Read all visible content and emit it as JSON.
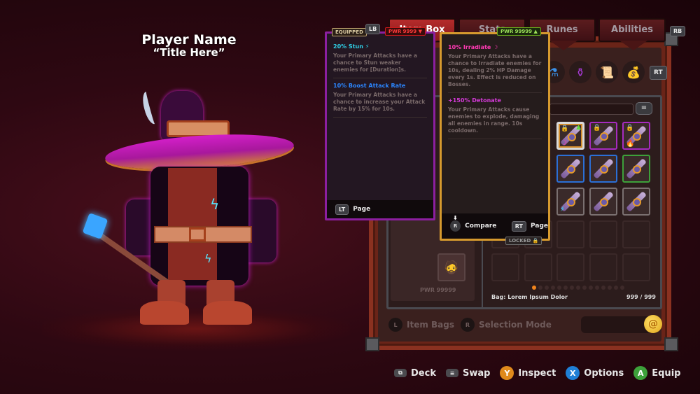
{
  "player": {
    "name": "Player Name",
    "title": "“Title Here”"
  },
  "tabs": [
    {
      "label": "Item Box",
      "active": true
    },
    {
      "label": "Stats",
      "active": false
    },
    {
      "label": "Runes",
      "active": false
    },
    {
      "label": "Abilities",
      "active": false
    }
  ],
  "shoulder_hints": {
    "left": "LB",
    "right": "RB",
    "rt": "RT"
  },
  "bag_tabs": [
    {
      "icon": "potion-bag-blue-icon",
      "glyph": "⚗"
    },
    {
      "icon": "potion-bag-purple-icon",
      "glyph": "⚱"
    },
    {
      "icon": "scroll-icon",
      "glyph": "📜"
    },
    {
      "icon": "coin-sack-icon",
      "glyph": "💰"
    }
  ],
  "equipped_tooltip": {
    "tag": "EQUIPPED",
    "power": "PWR 9999",
    "power_trend": "down",
    "power_color": "#ff3a3a",
    "effects": [
      {
        "title": "20% Stun ⚡",
        "color": "#2fd0e6",
        "desc": "Your Primary Attacks have a chance to Stun weaker enemies for [Duration]s."
      },
      {
        "title": "10% Boost Attack Rate",
        "color": "#2b86ff",
        "desc": "Your Primary Attacks have a chance to increase your Attack Rate by 15% for 10s."
      }
    ],
    "footer": {
      "button": "LT",
      "label": "Page"
    }
  },
  "compare_tooltip": {
    "power": "PWR 99999",
    "power_trend": "up",
    "power_color": "#9de35a",
    "effects": [
      {
        "title": "10% Irradiate ☽",
        "color": "#ff3ab4",
        "desc": "Your Primary Attacks have a chance to Irradiate enemies for 10s, dealing 2% HP Damage every 1s. Effect is reduced on Bosses."
      },
      {
        "title": "+150% Detonate",
        "color": "#d43ad8",
        "desc": "Your Primary Attacks cause enemies to explode, damaging all enemies in range. 10s cooldown."
      }
    ],
    "footer": {
      "compare_button": "R",
      "compare_label": "Compare",
      "page_button": "RT",
      "page_label": "Page"
    },
    "locked_tag": "LOCKED"
  },
  "inventory": {
    "items": [
      {
        "rarity_color": "#d18a2a",
        "locked": true,
        "selected": true,
        "upgrade": true,
        "badge": "☽",
        "badge_color": "#ff3ab4"
      },
      {
        "rarity_color": "#a62bc0",
        "locked": true,
        "selected": false,
        "upgrade": false,
        "badge": "",
        "badge_color": ""
      },
      {
        "rarity_color": "#a62bc0",
        "locked": true,
        "selected": false,
        "upgrade": false,
        "badge": "🔥",
        "badge_color": "#ff6a1a"
      },
      {
        "rarity_color": "#2b6fd6",
        "locked": false,
        "selected": false,
        "upgrade": false,
        "badge": "",
        "badge_color": ""
      },
      {
        "rarity_color": "#2b6fd6",
        "locked": false,
        "selected": false,
        "upgrade": false,
        "badge": "",
        "badge_color": ""
      },
      {
        "rarity_color": "#3da13a",
        "locked": false,
        "selected": false,
        "upgrade": false,
        "badge": "",
        "badge_color": ""
      },
      {
        "rarity_color": "#7a7070",
        "locked": false,
        "selected": false,
        "upgrade": false,
        "badge": "⚡",
        "badge_color": "#2fe6ff"
      },
      {
        "rarity_color": "#7a7070",
        "locked": false,
        "selected": false,
        "upgrade": false,
        "badge": "",
        "badge_color": ""
      },
      {
        "rarity_color": "#7a7070",
        "locked": false,
        "selected": false,
        "upgrade": false,
        "badge": "",
        "badge_color": ""
      }
    ],
    "page_count": 15,
    "current_page": 1,
    "bag_label": "Bag: Lorem Ipsum Dolor",
    "bag_count": "999 / 999"
  },
  "loadout": {
    "power": "PWR 99999"
  },
  "bottom_actions": {
    "item_bags": {
      "button": "L",
      "label": "Item Bags"
    },
    "selection_mode": {
      "button": "R",
      "label": "Selection Mode"
    }
  },
  "legend": [
    {
      "button": "⧉",
      "label": "Deck",
      "style": "rect",
      "color": "#4a4a4e"
    },
    {
      "button": "≡",
      "label": "Swap",
      "style": "rect",
      "color": "#4a4a4e"
    },
    {
      "button": "Y",
      "label": "Inspect",
      "style": "round",
      "color": "#e08a1c"
    },
    {
      "button": "X",
      "label": "Options",
      "style": "round",
      "color": "#1f7fd6"
    },
    {
      "button": "A",
      "label": "Equip",
      "style": "round",
      "color": "#3da13a"
    }
  ]
}
